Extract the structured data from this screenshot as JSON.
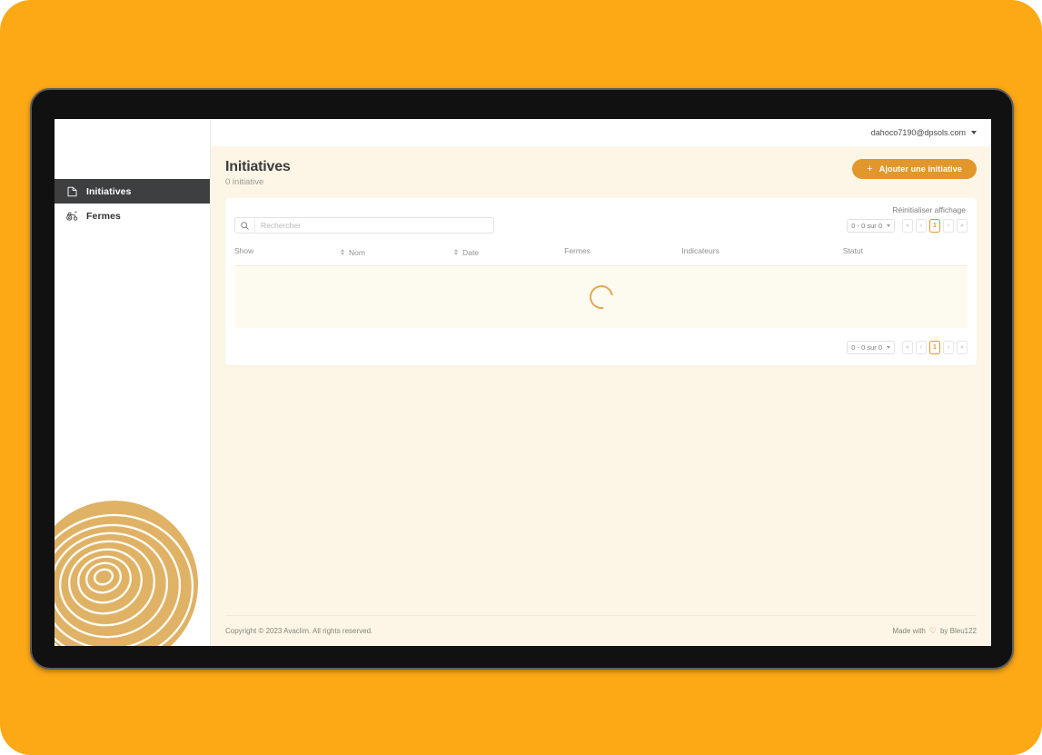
{
  "topbar": {
    "user_email": "dahoco7190@dpsols.com"
  },
  "sidebar": {
    "items": [
      {
        "label": "Initiatives",
        "icon": "document-icon",
        "active": true
      },
      {
        "label": "Fermes",
        "icon": "tractor-icon",
        "active": false
      }
    ]
  },
  "page": {
    "title": "Initiatives",
    "subtitle": "0 initiative",
    "add_button_label": "Ajouter une initiative",
    "add_button_plus": "+"
  },
  "card": {
    "reset_display_label": "Réinitialiser affichage",
    "search": {
      "placeholder": "Rechercher",
      "value": ""
    },
    "pagination": {
      "range_label": "0 - 0 sur 0",
      "first": "«",
      "prev": "‹",
      "current_page": "1",
      "next": "›",
      "last": "»"
    },
    "table": {
      "columns": [
        {
          "label": "Show",
          "sortable": false
        },
        {
          "label": "Nom",
          "sortable": true
        },
        {
          "label": "Date",
          "sortable": true
        },
        {
          "label": "Fermes",
          "sortable": false
        },
        {
          "label": "Indicateurs",
          "sortable": false
        },
        {
          "label": "Statut",
          "sortable": false
        }
      ],
      "rows": [],
      "loading": true
    }
  },
  "footer": {
    "copyright": "Copyright © 2023 Avaclim. All rights reserved.",
    "made_with_prefix": "Made with",
    "heart": "♡",
    "made_with_suffix": "by Bleu122"
  },
  "colors": {
    "accent": "#E2972C",
    "backdrop": "#FDA916",
    "page_bg": "#FDF6E6",
    "sidebar_active": "#3e3f41",
    "heart": "#E8445A"
  }
}
